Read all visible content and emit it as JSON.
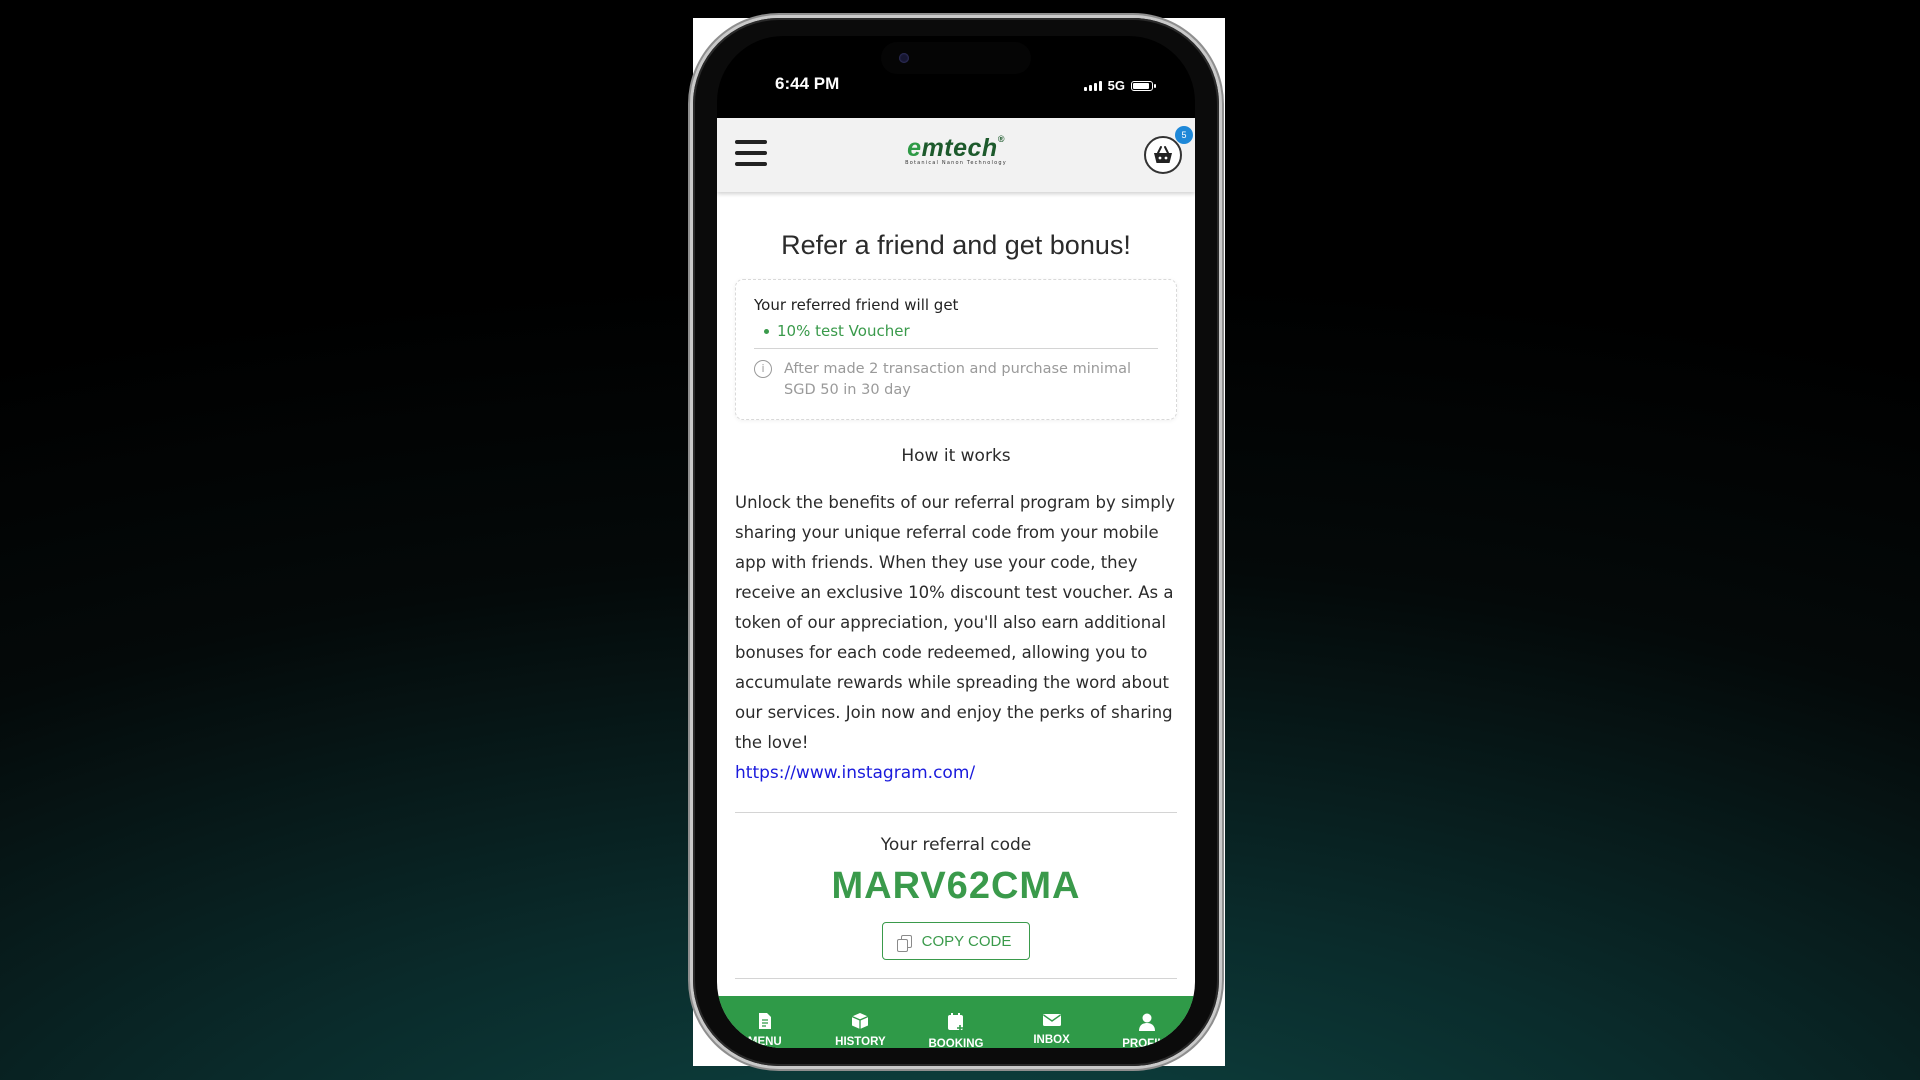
{
  "status_bar": {
    "time": "6:44 PM",
    "network": "5G"
  },
  "header": {
    "logo_text_e": "e",
    "logo_text_rest": "mtech",
    "logo_tagline": "Botanical Nanon Technology",
    "cart_count": "5"
  },
  "page": {
    "title": "Refer a friend and get bonus!",
    "reward_card": {
      "heading": "Your referred friend will get",
      "reward": "10% test Voucher",
      "note": "After made 2 transaction and purchase minimal SGD 50 in 30 day"
    },
    "how_title": "How it works",
    "description": "Unlock the benefits of our referral program by simply sharing your unique referral code from your mobile app with friends. When they use your code, they receive an exclusive 10% discount test voucher. As a token of our appreciation, you'll also earn additional bonuses for each code redeemed, allowing you to accumulate rewards while spreading the word about our services. Join now and enjoy the perks of sharing the love!",
    "link": "https://www.instagram.com/",
    "code_label": "Your referral code",
    "code": "MARV62CMA",
    "copy_button": "COPY CODE"
  },
  "tabs": [
    {
      "label": "MENU",
      "icon": "document-icon"
    },
    {
      "label": "HISTORY",
      "icon": "box-icon"
    },
    {
      "label": "BOOKING",
      "icon": "calendar-add-icon"
    },
    {
      "label": "INBOX",
      "icon": "envelope-icon"
    },
    {
      "label": "PROFILE",
      "icon": "person-icon"
    }
  ],
  "colors": {
    "brand_green": "#2f9a48",
    "accent_green": "#3a9a4b",
    "link_blue": "#1a1adc",
    "badge_blue": "#1e88d8"
  }
}
